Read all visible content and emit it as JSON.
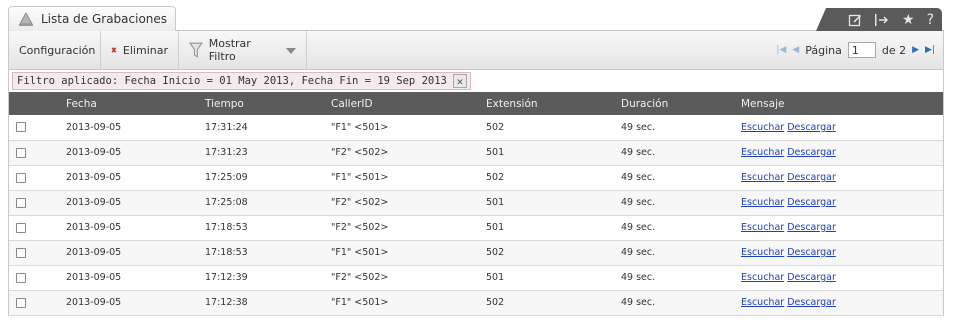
{
  "tab": {
    "title": "Lista de Grabaciones",
    "icon": "bell-icon"
  },
  "tools": [
    {
      "name": "edit-icon",
      "glyph": "☐"
    },
    {
      "name": "pin-icon",
      "glyph": "|→"
    },
    {
      "name": "star-icon",
      "glyph": "★"
    },
    {
      "name": "help-icon",
      "glyph": "?"
    }
  ],
  "toolbar": {
    "config_label": "Configuración",
    "delete_label": "Eliminar",
    "filter_label": "Mostrar Filtro"
  },
  "pager": {
    "label": "Página",
    "current": "1",
    "of_label": "de 2"
  },
  "filter": {
    "text": "Filtro aplicado: Fecha Inicio = 01 May 2013, Fecha Fin = 19 Sep 2013",
    "close": "✕"
  },
  "table": {
    "headers": [
      "",
      "Fecha",
      "Tiempo",
      "CallerID",
      "Extensión",
      "Duración",
      "Mensaje"
    ],
    "listen_label": "Escuchar",
    "download_label": "Descargar",
    "rows": [
      {
        "fecha": "2013-09-05",
        "tiempo": "17:31:24",
        "callerid": "\"F1\" <501>",
        "extension": "502",
        "duracion": "49 sec."
      },
      {
        "fecha": "2013-09-05",
        "tiempo": "17:31:23",
        "callerid": "\"F2\" <502>",
        "extension": "501",
        "duracion": "49 sec."
      },
      {
        "fecha": "2013-09-05",
        "tiempo": "17:25:09",
        "callerid": "\"F1\" <501>",
        "extension": "502",
        "duracion": "49 sec."
      },
      {
        "fecha": "2013-09-05",
        "tiempo": "17:25:08",
        "callerid": "\"F2\" <502>",
        "extension": "501",
        "duracion": "49 sec."
      },
      {
        "fecha": "2013-09-05",
        "tiempo": "17:18:53",
        "callerid": "\"F2\" <502>",
        "extension": "501",
        "duracion": "49 sec."
      },
      {
        "fecha": "2013-09-05",
        "tiempo": "17:18:53",
        "callerid": "\"F1\" <501>",
        "extension": "502",
        "duracion": "49 sec."
      },
      {
        "fecha": "2013-09-05",
        "tiempo": "17:12:39",
        "callerid": "\"F2\" <502>",
        "extension": "501",
        "duracion": "49 sec."
      },
      {
        "fecha": "2013-09-05",
        "tiempo": "17:12:38",
        "callerid": "\"F1\" <501>",
        "extension": "502",
        "duracion": "49 sec."
      }
    ]
  }
}
